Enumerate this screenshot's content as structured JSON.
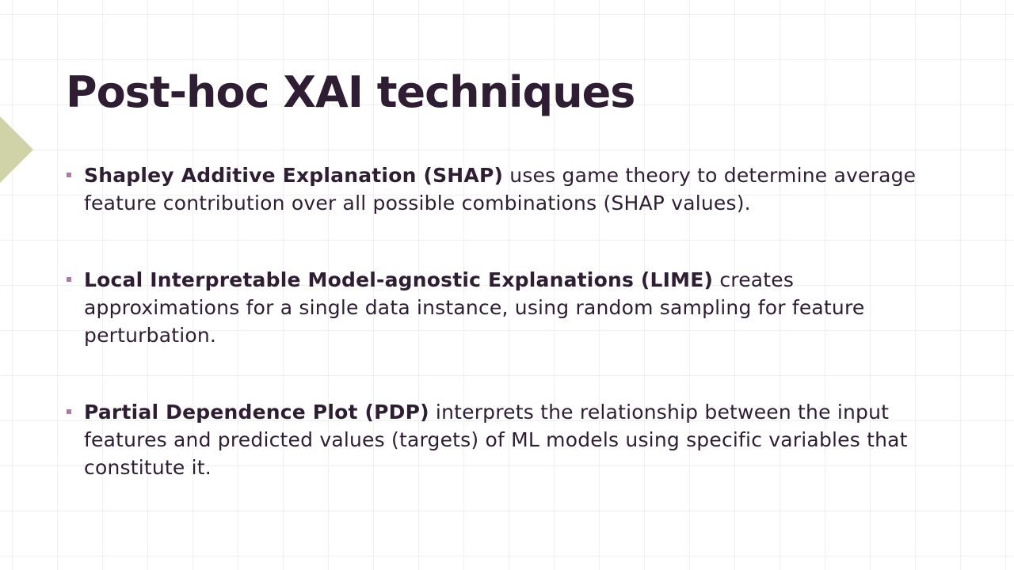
{
  "slide": {
    "title": "Post-hoc XAI techniques",
    "bullets": [
      {
        "term": "Shapley Additive Explanation (SHAP)",
        "text": " uses game theory to determine average feature contribution over all possible combinations (SHAP values)."
      },
      {
        "term": "Local Interpretable Model-agnostic Explanations (LIME)",
        "text": " creates approximations for a single data instance, using random sampling for feature perturbation."
      },
      {
        "term": "Partial Dependence Plot (PDP)",
        "text": " interprets the relationship between the input features and predicted values (targets) of ML models using specific variables that constitute it."
      }
    ]
  },
  "colors": {
    "background": "#ffffff",
    "grid_line": "#efefef",
    "text": "#2f1d34",
    "accent_triangle": "#d0d3a8",
    "bullet_marker": "#b07aa6"
  },
  "icons": {
    "accent": "triangle-arrow-icon",
    "bullet": "square-bullet-icon"
  }
}
